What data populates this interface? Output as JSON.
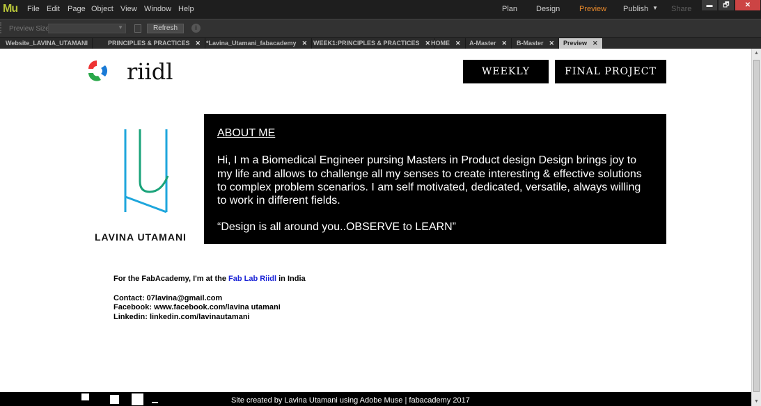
{
  "app": {
    "logo": "Mu",
    "menu": [
      "File",
      "Edit",
      "Page",
      "Object",
      "View",
      "Window",
      "Help"
    ],
    "modes": {
      "plan": "Plan",
      "design": "Design",
      "preview": "Preview",
      "publish": "Publish",
      "share": "Share"
    },
    "window_controls": {
      "minimize": "▬",
      "restore": "🗗",
      "close": "✕"
    }
  },
  "toolbar": {
    "preview_size_label": "Preview Size:",
    "refresh_label": "Refresh"
  },
  "tabs": [
    {
      "label": "Website_LAVINA_UTAMANI"
    },
    {
      "label": "PRINCIPLES & PRACTICES"
    },
    {
      "label": "*Lavina_Utamani_fabacademy"
    },
    {
      "label": "WEEK1:PRINCIPLES & PRACTICES"
    },
    {
      "label": "HOME"
    },
    {
      "label": "A-Master"
    },
    {
      "label": "B-Master"
    },
    {
      "label": "Preview",
      "active": true
    }
  ],
  "site": {
    "brand": "riidl",
    "nav": {
      "weekly": "WEEKLY",
      "final_project": "FINAL PROJECT"
    },
    "name": "LAVINA UTAMANI",
    "about": {
      "heading": "ABOUT ME",
      "body": "Hi, I m a Biomedical Engineer pursing Masters in  Product design Design brings joy to my life and allows to challenge all my senses to create interesting & effective solutions to complex problem scenarios. I am self motivated, dedicated, versatile, always willing to work in different fields.",
      "quote": "“Design is all around you..OBSERVE to LEARN”"
    },
    "fab": {
      "prefix": "For the FabAcademy, I'm at the ",
      "link": "Fab Lab Riidl",
      "suffix": " in India"
    },
    "contact": "Contact: 07lavina@gmail.com",
    "facebook": "Facebook: www.facebook.com/lavina utamani",
    "linkedin": "Linkedin: linkedin.com/lavinautamani",
    "footer": "Site created by Lavina Utamani using Adobe Muse | fabacademy 2017"
  },
  "colors": {
    "accent_orange": "#e8892b",
    "link_blue": "#1a23d6",
    "logo_cyan": "#1ea6dc",
    "logo_green": "#1aa37a"
  }
}
